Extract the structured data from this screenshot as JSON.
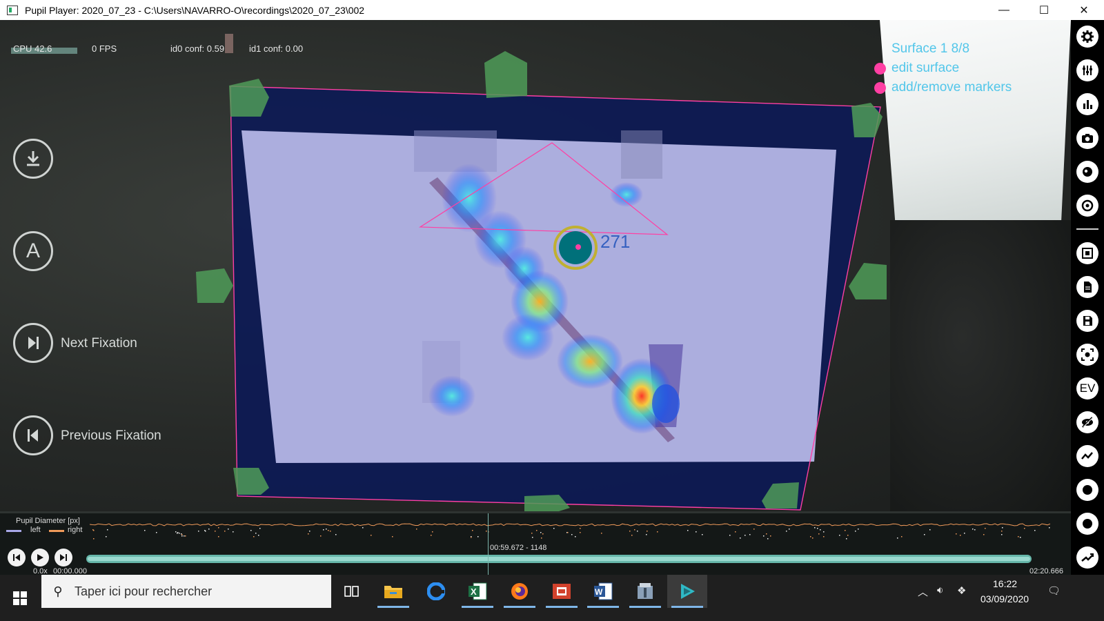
{
  "window": {
    "title": "Pupil Player: 2020_07_23 - C:\\Users\\NAVARRO-O\\recordings\\2020_07_23\\002",
    "minimize": "—",
    "maximize": "☐",
    "close": "✕"
  },
  "stats": {
    "cpu": "CPU 42.6",
    "fps": "0 FPS",
    "id0_conf": "id0 conf: 0.59",
    "id1_conf": "id1 conf: 0.00"
  },
  "side_buttons": {
    "download_icon": "download-icon",
    "annotation_label": "A",
    "next_fixation": "Next Fixation",
    "previous_fixation": "Previous Fixation"
  },
  "surface_menu": {
    "title": "Surface 1   8/8",
    "edit_surface": "edit surface",
    "add_remove_markers": "add/remove markers",
    "color": "#52c6ea",
    "dot_color": "#ff3fa3"
  },
  "scene": {
    "fixation_id": "271"
  },
  "timeline": {
    "pupil_label": "Pupil Diameter [px]",
    "legend_left": "left",
    "legend_right": "right",
    "left_color": "#a9a8e8",
    "right_color": "#f09a5a",
    "current": "00:59.672 - 1148",
    "speed": "0.0x",
    "start_time": "00:00.000",
    "end_time": "02:20.666",
    "playhead_fraction": 0.425
  },
  "iconbar": {
    "items": [
      "gear-icon",
      "sliders-icon",
      "bar-chart-icon",
      "camera-icon",
      "eye-icon",
      "target-icon",
      "surface-icon",
      "document-icon",
      "save-icon",
      "screenshot-icon",
      "EV",
      "hidden-eye-icon",
      "line-chart-icon",
      "circle-icon",
      "ring-icon",
      "trend-icon"
    ]
  },
  "taskbar": {
    "search_placeholder": "Taper ici pour rechercher",
    "apps": [
      "task-view-icon",
      "file-explorer-icon",
      "edge-icon",
      "excel-icon",
      "firefox-icon",
      "acrobat-icon",
      "word-icon",
      "archive-icon",
      "pupil-player-icon"
    ],
    "time": "16:22",
    "date": "03/09/2020"
  }
}
